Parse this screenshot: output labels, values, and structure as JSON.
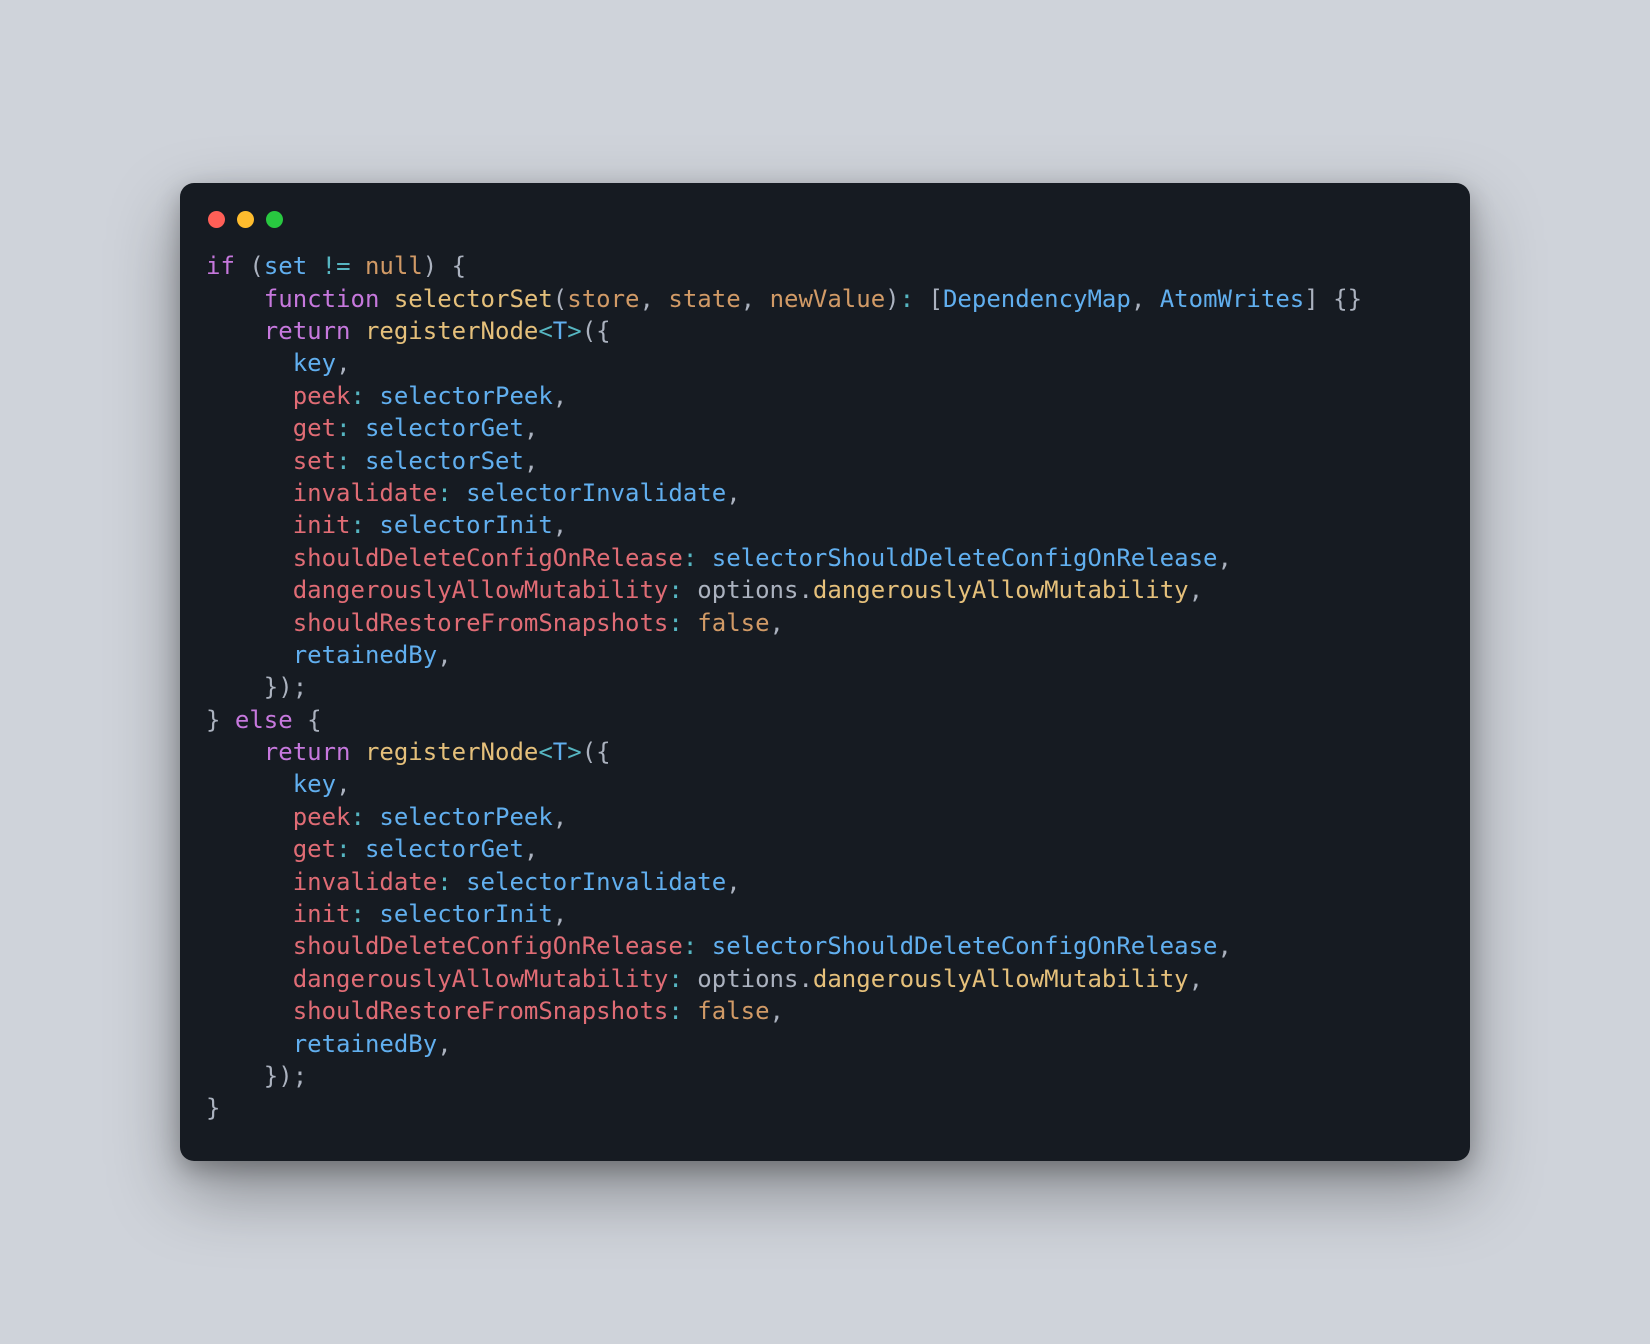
{
  "colors": {
    "page_bg": "#cfd3da",
    "window_bg": "#161b22",
    "traffic_red": "#ff5f57",
    "traffic_yellow": "#febc2e",
    "traffic_green": "#28c840",
    "tok_keyword": "#c678dd",
    "tok_func": "#e5c07b",
    "tok_type": "#61afef",
    "tok_var": "#61afef",
    "tok_id": "#abb2bf",
    "tok_prop": "#e06c75",
    "tok_op": "#56b6c2",
    "tok_lit": "#d19a66",
    "tok_pun": "#abb2bf",
    "tok_param": "#d19a66"
  },
  "code": {
    "language": "typescript",
    "lines": [
      [
        [
          "kw",
          "if"
        ],
        [
          "pun",
          " ("
        ],
        [
          "var",
          "set"
        ],
        [
          "pun",
          " "
        ],
        [
          "op",
          "!="
        ],
        [
          "pun",
          " "
        ],
        [
          "lit",
          "null"
        ],
        [
          "pun",
          ") {"
        ]
      ],
      [
        [
          "pun",
          "    "
        ],
        [
          "kw",
          "function"
        ],
        [
          "pun",
          " "
        ],
        [
          "fn",
          "selectorSet"
        ],
        [
          "pun",
          "("
        ],
        [
          "parm",
          "store"
        ],
        [
          "pun",
          ", "
        ],
        [
          "parm",
          "state"
        ],
        [
          "pun",
          ", "
        ],
        [
          "parm",
          "newValue"
        ],
        [
          "pun",
          ")"
        ],
        [
          "op",
          ":"
        ],
        [
          "pun",
          " ["
        ],
        [
          "typ",
          "DependencyMap"
        ],
        [
          "pun",
          ", "
        ],
        [
          "typ",
          "AtomWrites"
        ],
        [
          "pun",
          "] {}"
        ]
      ],
      [
        [
          "pun",
          "    "
        ],
        [
          "kw",
          "return"
        ],
        [
          "pun",
          " "
        ],
        [
          "fn",
          "registerNode"
        ],
        [
          "op",
          "<"
        ],
        [
          "typ",
          "T"
        ],
        [
          "op",
          ">"
        ],
        [
          "pun",
          "({"
        ]
      ],
      [
        [
          "pun",
          "      "
        ],
        [
          "var",
          "key"
        ],
        [
          "pun",
          ","
        ]
      ],
      [
        [
          "pun",
          "      "
        ],
        [
          "prop",
          "peek"
        ],
        [
          "op",
          ":"
        ],
        [
          "pun",
          " "
        ],
        [
          "var",
          "selectorPeek"
        ],
        [
          "pun",
          ","
        ]
      ],
      [
        [
          "pun",
          "      "
        ],
        [
          "prop",
          "get"
        ],
        [
          "op",
          ":"
        ],
        [
          "pun",
          " "
        ],
        [
          "var",
          "selectorGet"
        ],
        [
          "pun",
          ","
        ]
      ],
      [
        [
          "pun",
          "      "
        ],
        [
          "prop",
          "set"
        ],
        [
          "op",
          ":"
        ],
        [
          "pun",
          " "
        ],
        [
          "var",
          "selectorSet"
        ],
        [
          "pun",
          ","
        ]
      ],
      [
        [
          "pun",
          "      "
        ],
        [
          "prop",
          "invalidate"
        ],
        [
          "op",
          ":"
        ],
        [
          "pun",
          " "
        ],
        [
          "var",
          "selectorInvalidate"
        ],
        [
          "pun",
          ","
        ]
      ],
      [
        [
          "pun",
          "      "
        ],
        [
          "prop",
          "init"
        ],
        [
          "op",
          ":"
        ],
        [
          "pun",
          " "
        ],
        [
          "var",
          "selectorInit"
        ],
        [
          "pun",
          ","
        ]
      ],
      [
        [
          "pun",
          "      "
        ],
        [
          "prop",
          "shouldDeleteConfigOnRelease"
        ],
        [
          "op",
          ":"
        ],
        [
          "pun",
          " "
        ],
        [
          "var",
          "selectorShouldDeleteConfigOnRelease"
        ],
        [
          "pun",
          ","
        ]
      ],
      [
        [
          "pun",
          "      "
        ],
        [
          "prop",
          "dangerouslyAllowMutability"
        ],
        [
          "op",
          ":"
        ],
        [
          "pun",
          " "
        ],
        [
          "id",
          "options"
        ],
        [
          "pun",
          "."
        ],
        [
          "fn",
          "dangerouslyAllowMutability"
        ],
        [
          "pun",
          ","
        ]
      ],
      [
        [
          "pun",
          "      "
        ],
        [
          "prop",
          "shouldRestoreFromSnapshots"
        ],
        [
          "op",
          ":"
        ],
        [
          "pun",
          " "
        ],
        [
          "lit",
          "false"
        ],
        [
          "pun",
          ","
        ]
      ],
      [
        [
          "pun",
          "      "
        ],
        [
          "var",
          "retainedBy"
        ],
        [
          "pun",
          ","
        ]
      ],
      [
        [
          "pun",
          "    });"
        ]
      ],
      [
        [
          "pun",
          "} "
        ],
        [
          "kw",
          "else"
        ],
        [
          "pun",
          " {"
        ]
      ],
      [
        [
          "pun",
          "    "
        ],
        [
          "kw",
          "return"
        ],
        [
          "pun",
          " "
        ],
        [
          "fn",
          "registerNode"
        ],
        [
          "op",
          "<"
        ],
        [
          "typ",
          "T"
        ],
        [
          "op",
          ">"
        ],
        [
          "pun",
          "({"
        ]
      ],
      [
        [
          "pun",
          "      "
        ],
        [
          "var",
          "key"
        ],
        [
          "pun",
          ","
        ]
      ],
      [
        [
          "pun",
          "      "
        ],
        [
          "prop",
          "peek"
        ],
        [
          "op",
          ":"
        ],
        [
          "pun",
          " "
        ],
        [
          "var",
          "selectorPeek"
        ],
        [
          "pun",
          ","
        ]
      ],
      [
        [
          "pun",
          "      "
        ],
        [
          "prop",
          "get"
        ],
        [
          "op",
          ":"
        ],
        [
          "pun",
          " "
        ],
        [
          "var",
          "selectorGet"
        ],
        [
          "pun",
          ","
        ]
      ],
      [
        [
          "pun",
          "      "
        ],
        [
          "prop",
          "invalidate"
        ],
        [
          "op",
          ":"
        ],
        [
          "pun",
          " "
        ],
        [
          "var",
          "selectorInvalidate"
        ],
        [
          "pun",
          ","
        ]
      ],
      [
        [
          "pun",
          "      "
        ],
        [
          "prop",
          "init"
        ],
        [
          "op",
          ":"
        ],
        [
          "pun",
          " "
        ],
        [
          "var",
          "selectorInit"
        ],
        [
          "pun",
          ","
        ]
      ],
      [
        [
          "pun",
          "      "
        ],
        [
          "prop",
          "shouldDeleteConfigOnRelease"
        ],
        [
          "op",
          ":"
        ],
        [
          "pun",
          " "
        ],
        [
          "var",
          "selectorShouldDeleteConfigOnRelease"
        ],
        [
          "pun",
          ","
        ]
      ],
      [
        [
          "pun",
          "      "
        ],
        [
          "prop",
          "dangerouslyAllowMutability"
        ],
        [
          "op",
          ":"
        ],
        [
          "pun",
          " "
        ],
        [
          "id",
          "options"
        ],
        [
          "pun",
          "."
        ],
        [
          "fn",
          "dangerouslyAllowMutability"
        ],
        [
          "pun",
          ","
        ]
      ],
      [
        [
          "pun",
          "      "
        ],
        [
          "prop",
          "shouldRestoreFromSnapshots"
        ],
        [
          "op",
          ":"
        ],
        [
          "pun",
          " "
        ],
        [
          "lit",
          "false"
        ],
        [
          "pun",
          ","
        ]
      ],
      [
        [
          "pun",
          "      "
        ],
        [
          "var",
          "retainedBy"
        ],
        [
          "pun",
          ","
        ]
      ],
      [
        [
          "pun",
          "    });"
        ]
      ],
      [
        [
          "pun",
          "}"
        ]
      ]
    ]
  }
}
